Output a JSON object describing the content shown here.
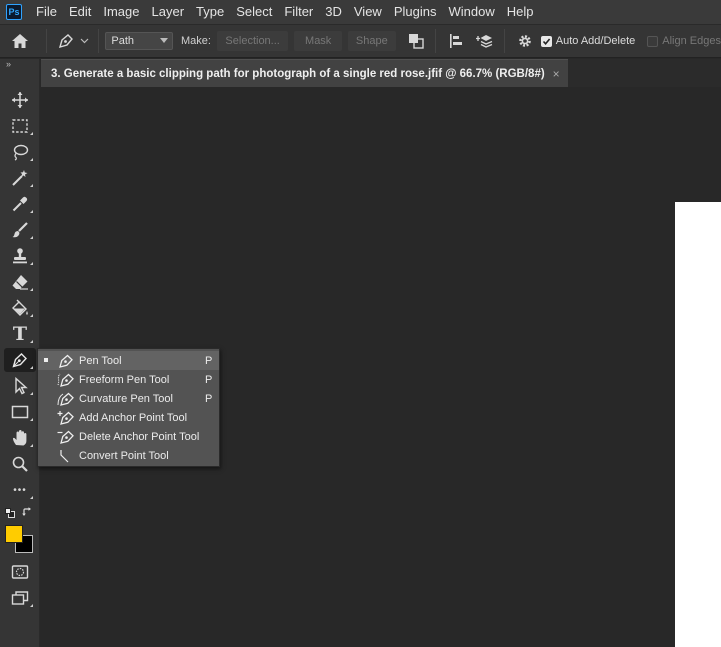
{
  "app": {
    "logo_text": "Ps"
  },
  "menu": [
    "File",
    "Edit",
    "Image",
    "Layer",
    "Type",
    "Select",
    "Filter",
    "3D",
    "View",
    "Plugins",
    "Window",
    "Help"
  ],
  "options_bar": {
    "mode_select": "Path",
    "make_label": "Make:",
    "selection_button": "Selection...",
    "mask_button": "Mask",
    "shape_button": "Shape",
    "auto_add_delete": {
      "label": "Auto Add/Delete",
      "checked": true
    },
    "align_edges": {
      "label": "Align Edges",
      "checked": false
    }
  },
  "document": {
    "tab_title": "3. Generate a basic clipping path for photograph of a single red rose.jfif @ 66.7% (RGB/8#)",
    "close_glyph": "×"
  },
  "toolbar": {
    "collapse_glyph": "»",
    "tools": [
      {
        "name": "move-tool",
        "icon": "move-icon"
      },
      {
        "name": "marquee-tool",
        "icon": "marquee-icon"
      },
      {
        "name": "lasso-tool",
        "icon": "lasso-icon"
      },
      {
        "name": "magic-wand-tool",
        "icon": "magic-wand-icon"
      },
      {
        "name": "eyedropper-tool",
        "icon": "eyedropper-icon"
      },
      {
        "name": "brush-tool",
        "icon": "brush-icon"
      },
      {
        "name": "stamp-tool",
        "icon": "stamp-icon"
      },
      {
        "name": "eraser-tool",
        "icon": "eraser-icon"
      },
      {
        "name": "paint-bucket-tool",
        "icon": "paint-bucket-icon"
      },
      {
        "name": "type-tool",
        "icon": "type-icon",
        "glyph": "T"
      },
      {
        "name": "pen-tool",
        "icon": "pen-icon"
      },
      {
        "name": "path-selection-tool",
        "icon": "arrow-icon"
      },
      {
        "name": "rectangle-tool",
        "icon": "rectangle-icon"
      },
      {
        "name": "hand-tool",
        "icon": "hand-icon"
      },
      {
        "name": "zoom-tool",
        "icon": "zoom-icon"
      },
      {
        "name": "more-tools",
        "icon": "ellipsis-icon",
        "glyph": "•••"
      }
    ],
    "foreground_color": "#ffcc00",
    "background_color": "#000000"
  },
  "pen_flyout": [
    {
      "label": "Pen Tool",
      "shortcut": "P",
      "selected": true
    },
    {
      "label": "Freeform Pen Tool",
      "shortcut": "P",
      "selected": false
    },
    {
      "label": "Curvature Pen Tool",
      "shortcut": "P",
      "selected": false
    },
    {
      "label": "Add Anchor Point Tool",
      "shortcut": "",
      "selected": false
    },
    {
      "label": "Delete Anchor Point Tool",
      "shortcut": "",
      "selected": false
    },
    {
      "label": "Convert Point Tool",
      "shortcut": "",
      "selected": false
    }
  ]
}
